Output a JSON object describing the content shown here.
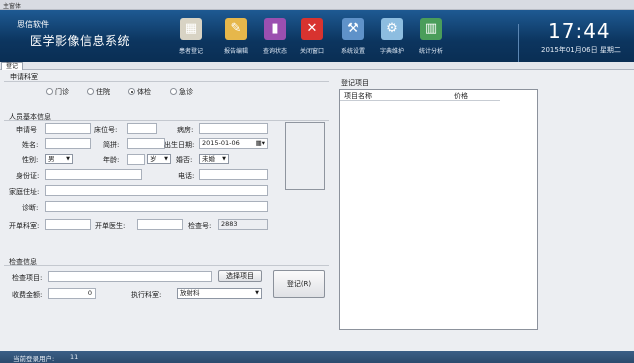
{
  "window": {
    "title": "主窗体"
  },
  "header": {
    "company": "思信软件",
    "app_name": "医学影像信息系统",
    "time": "17:44",
    "date": "2015年01月06日 星期二",
    "toolbar": [
      {
        "label": "患者登记",
        "icon": "patient-register-icon",
        "color": "#d8d3c4"
      },
      {
        "label": "报告编辑",
        "icon": "report-edit-icon",
        "color": "#e6b74b"
      },
      {
        "label": "查询状态",
        "icon": "query-status-icon",
        "color": "#9b4fb0"
      },
      {
        "label": "关闭窗口",
        "icon": "close-window-icon",
        "color": "#d8332f"
      },
      {
        "label": "系统设置",
        "icon": "system-settings-icon",
        "color": "#5f92c9"
      },
      {
        "label": "字典维护",
        "icon": "dictionary-icon",
        "color": "#8dbde0"
      },
      {
        "label": "统计分析",
        "icon": "statistics-icon",
        "color": "#4a9d5a"
      }
    ]
  },
  "tabs": [
    "登记"
  ],
  "dept": {
    "title": "申请科室",
    "options": [
      "门诊",
      "住院",
      "体检",
      "急诊"
    ],
    "selected": 2
  },
  "patient": {
    "title": "人员基本信息",
    "apply_no": "申请号",
    "bed_no": "床位号:",
    "ward": "病房:",
    "name": "姓名:",
    "pinyin": "简拼:",
    "dob_label": "出生日期:",
    "dob": "2015-01-06",
    "gender_label": "性别:",
    "gender": "男",
    "age_label": "年龄:",
    "age_unit": "岁",
    "marriage_label": "婚否:",
    "marriage": "未婚",
    "id_card": "身份证:",
    "phone": "电话:",
    "address": "家庭住址:",
    "diagnosis": "诊断:",
    "dept": "开单科室:",
    "doctor": "开单医生:",
    "check_no_label": "检查号:",
    "check_no": "2883"
  },
  "exam": {
    "title": "检查信息",
    "item_label": "检查项目:",
    "choose_btn": "选择项目",
    "fee_label": "收费金额:",
    "fee": "0",
    "exec_label": "执行科室:",
    "exec_dept": "放射科",
    "register_btn": "登记(R)"
  },
  "grid": {
    "title": "登记项目",
    "columns": [
      "项目名称",
      "价格"
    ]
  },
  "status": {
    "label": "当前登录用户:",
    "user": "11"
  }
}
